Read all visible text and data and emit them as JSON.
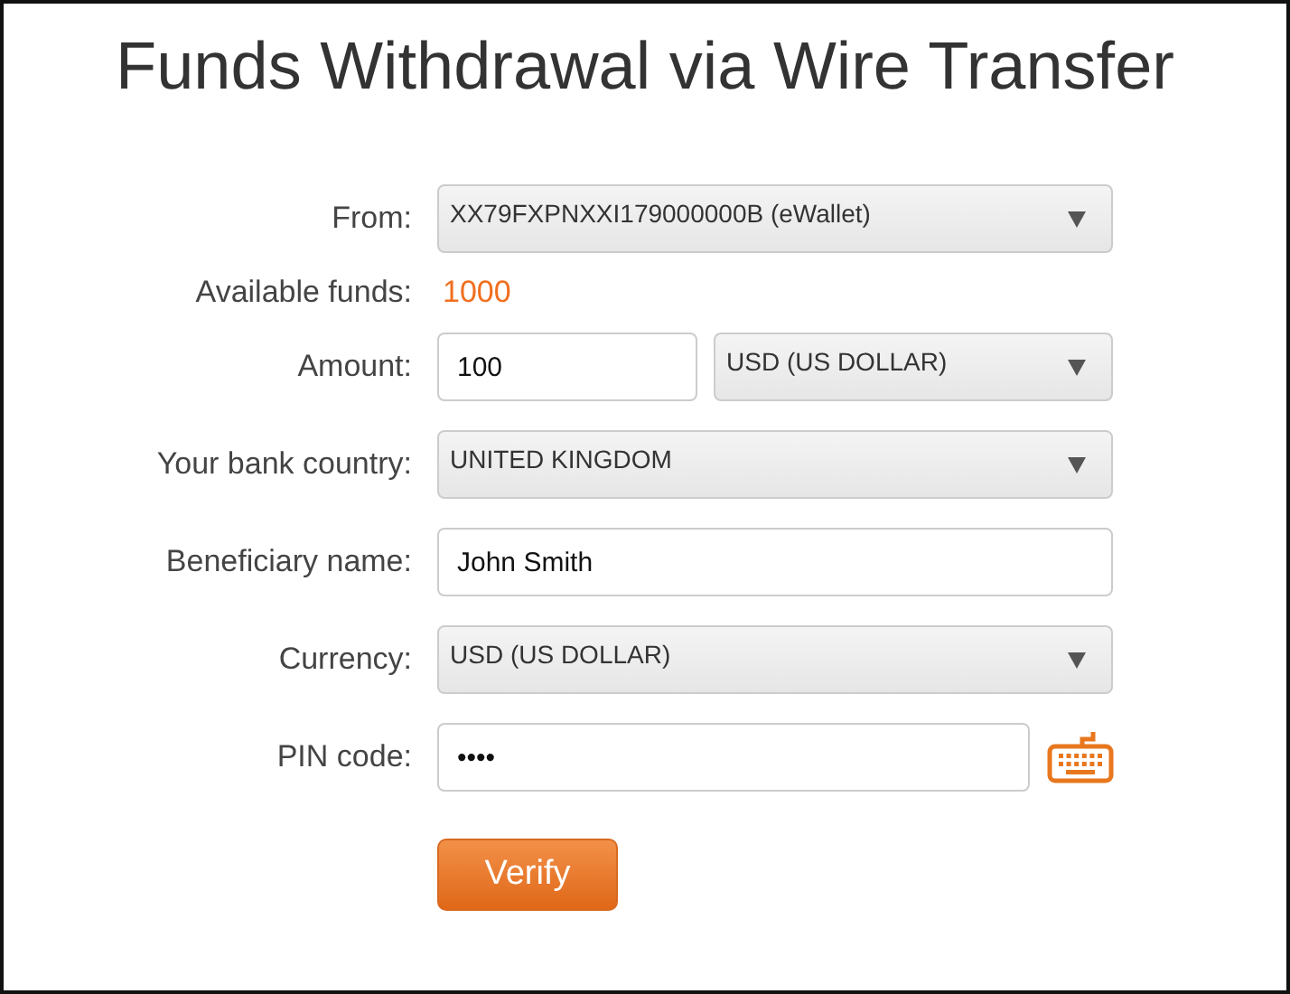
{
  "title": "Funds Withdrawal via Wire Transfer",
  "fields": [
    {
      "kind": "select",
      "label": "From:",
      "value": "XX79FXPNXXI179000000B (eWallet)"
    },
    {
      "kind": "info",
      "label": "Available funds:",
      "value": "1000"
    },
    {
      "kind": "amount",
      "label": "Amount:",
      "value": "100",
      "currency": "USD (US DOLLAR)"
    },
    {
      "kind": "select",
      "label": "Your bank country:",
      "value": "UNITED KINGDOM"
    },
    {
      "kind": "text",
      "label": "Beneficiary name:",
      "value": "John Smith"
    },
    {
      "kind": "select",
      "label": "Currency:",
      "value": "USD (US DOLLAR)"
    },
    {
      "kind": "pin",
      "label": "PIN code:",
      "value": "••••"
    }
  ],
  "button": "Verify"
}
